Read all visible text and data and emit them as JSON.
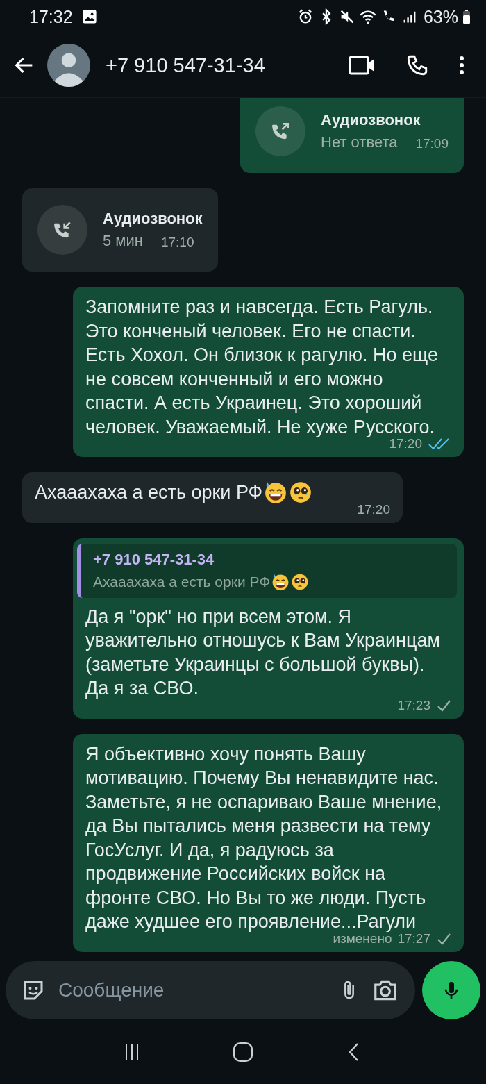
{
  "status_bar": {
    "time": "17:32",
    "battery": "63%"
  },
  "header": {
    "contact": "+7 910 547-31-34"
  },
  "messages": [
    {
      "kind": "call",
      "outgoing": true,
      "title": "Аудиозвонок",
      "detail": "Нет ответа",
      "time": "17:09"
    },
    {
      "kind": "call",
      "outgoing": false,
      "title": "Аудиозвонок",
      "detail": "5 мин",
      "time": "17:10"
    },
    {
      "kind": "text",
      "outgoing": true,
      "text": "Запомните раз и навсегда. Есть Рагуль. Это конченый человек. Его не спасти.  Есть Хохол. Он близок к рагулю. Но еще не совсем конченный и его можно спасти. А есть Украинец. Это хороший человек. Уважаемый. Не хуже Русского.",
      "time": "17:20",
      "read": true
    },
    {
      "kind": "text",
      "outgoing": false,
      "text": "Ахаааxаха а есть орки РФ",
      "emoji": [
        {
          "kind": "sweat-smile"
        },
        {
          "kind": "pleading"
        }
      ],
      "time": "17:20"
    },
    {
      "kind": "text",
      "outgoing": true,
      "quote": {
        "author": "+7 910 547-31-34",
        "text": "Ахаааxаха а есть орки РФ",
        "emoji": [
          {
            "kind": "sweat-smile"
          },
          {
            "kind": "pleading"
          }
        ]
      },
      "text": "Да я \"орк\" но при всем этом. Я уважительно отношусь к Вам Украинцам (заметьте Украинцы с большой буквы). Да я за СВО.",
      "time": "17:23",
      "read": false
    },
    {
      "kind": "text",
      "outgoing": true,
      "text": "Я объективно хочу понять Вашу мотивацию. Почему Вы ненавидите нас. Заметьте,  я не оспариваю Ваше мнение, да Вы пытались меня развести на тему ГосУслуг. И да, я радуюсь за продвижение Российских войск на фронте СВО. Но Вы то же люди. Пусть даже худшее его проявление...Рагули",
      "edited_label": "изменено",
      "time": "17:27",
      "read": false
    }
  ],
  "composer": {
    "placeholder": "Сообщение"
  }
}
